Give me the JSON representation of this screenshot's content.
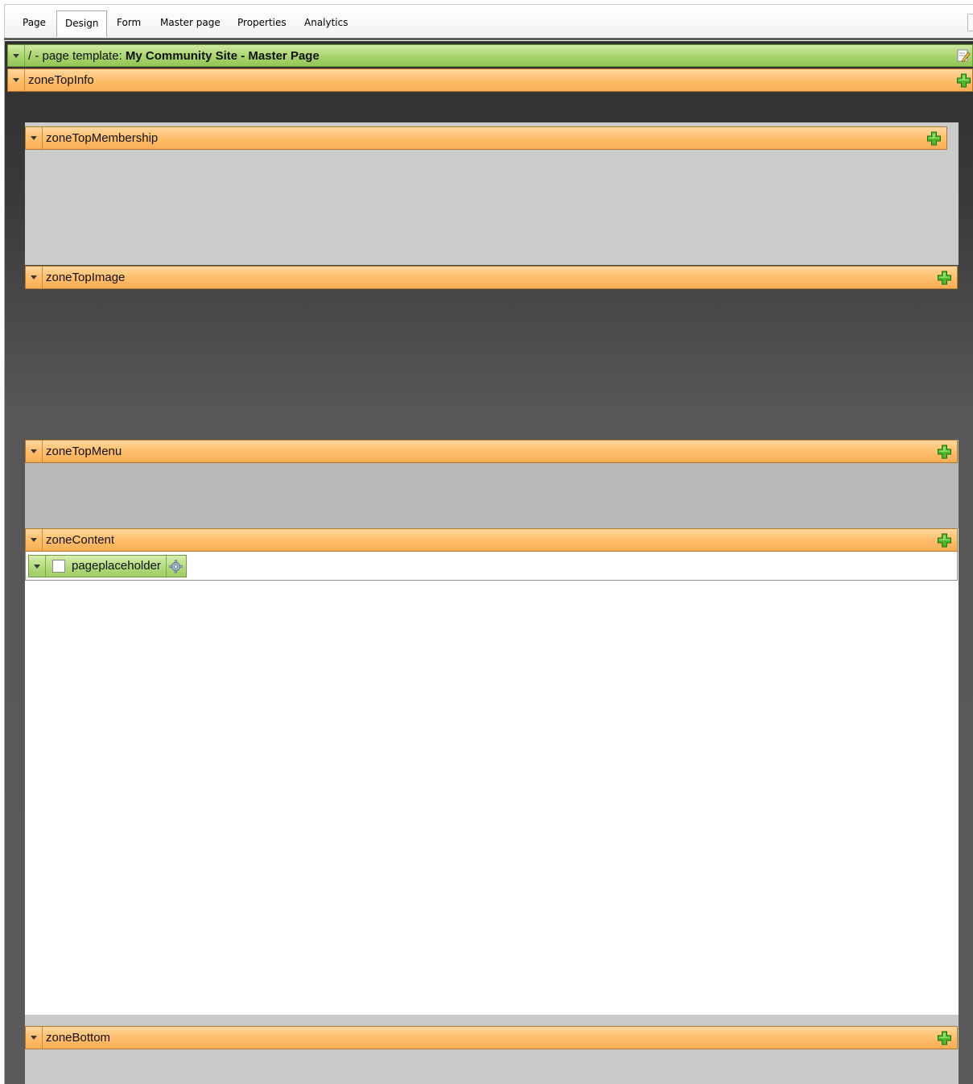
{
  "tabs": [
    {
      "label": "Page"
    },
    {
      "label": "Design",
      "active": true
    },
    {
      "label": "Form"
    },
    {
      "label": "Master page"
    },
    {
      "label": "Properties"
    },
    {
      "label": "Analytics"
    }
  ],
  "template": {
    "prefix": "/ - page template: ",
    "name": "My Community Site - Master Page"
  },
  "zones": {
    "top_info": "zoneTopInfo",
    "top_membership": "zoneTopMembership",
    "top_image": "zoneTopImage",
    "top_menu": "zoneTopMenu",
    "content": "zoneContent",
    "bottom": "zoneBottom"
  },
  "webpart": {
    "label": "pageplaceholder",
    "icon": "gear-icon"
  },
  "icons": {
    "zone_add": "add-webpart-icon",
    "template_edit": "edit-template-icon",
    "collapse": "chevron-down-icon"
  },
  "colors": {
    "zone_header": "#ffbf6c",
    "template_header": "#a8d46e",
    "webpart_header": "#b2da7c",
    "canvas_dark": "#3a3a3a",
    "zone_body_light": "#cbcbcb",
    "zone_body_mid": "#b9b9b9"
  }
}
